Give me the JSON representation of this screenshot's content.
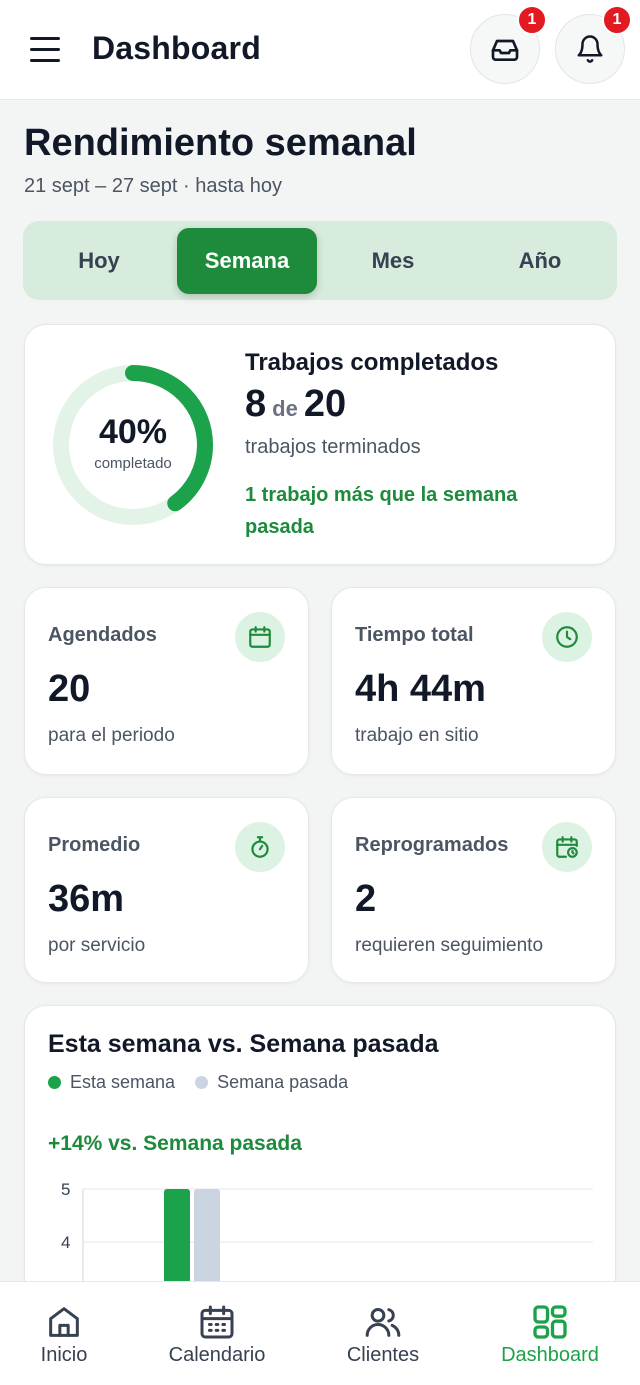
{
  "app": {
    "title": "Dashboard"
  },
  "header": {
    "menu_icon": "menu-icon",
    "inbox": {
      "icon": "inbox-icon",
      "badge": "1"
    },
    "notifications": {
      "icon": "bell-icon",
      "badge": "1"
    }
  },
  "page": {
    "title": "Rendimiento semanal",
    "date_range": "21 sept – 27 sept · hasta hoy"
  },
  "segments": {
    "items": [
      "Hoy",
      "Semana",
      "Mes",
      "Año"
    ],
    "selected": "Semana"
  },
  "summary": {
    "percent_label": "40%",
    "percent_value": 0.4,
    "percent_caption": "completado",
    "title": "Trabajos completados",
    "completed": "8",
    "of_word": "de",
    "total": "20",
    "description": "trabajos terminados",
    "delta": "1 trabajo más que la semana pasada"
  },
  "stats": [
    {
      "label": "Agendados",
      "value": "20",
      "sub": "para el periodo",
      "icon": "calendar-icon"
    },
    {
      "label": "Tiempo total",
      "value": "4h 44m",
      "sub": "trabajo en sitio",
      "icon": "clock-icon"
    },
    {
      "label": "Promedio",
      "value": "36m",
      "sub": "por servicio",
      "icon": "stopwatch-icon"
    },
    {
      "label": "Reprogramados",
      "value": "2",
      "sub": "requieren seguimiento",
      "icon": "calendar-clock-icon"
    }
  ],
  "comparison": {
    "title": "Esta semana vs. Semana pasada",
    "legend": [
      "Esta semana",
      "Semana pasada"
    ],
    "delta": "+14% vs. Semana pasada"
  },
  "chart_data": {
    "type": "bar",
    "title": "Esta semana vs. Semana pasada",
    "series": [
      {
        "name": "Esta semana",
        "values": [
          5
        ]
      },
      {
        "name": "Semana pasada",
        "values": [
          5
        ]
      }
    ],
    "ylim": [
      0,
      5
    ],
    "yticks": [
      "5",
      "4"
    ],
    "colors": [
      "#1ca24a",
      "#cbd5e1"
    ]
  },
  "nav": {
    "items": [
      {
        "label": "Inicio",
        "icon": "home-icon"
      },
      {
        "label": "Calendario",
        "icon": "calendar-icon"
      },
      {
        "label": "Clientes",
        "icon": "users-icon"
      },
      {
        "label": "Dashboard",
        "icon": "dashboard-grid-icon"
      }
    ],
    "active": "Dashboard"
  },
  "colors": {
    "accent": "#1e8a3c",
    "accent_light": "#d7ecdc",
    "badge": "#e21b23",
    "muted_bar": "#cbd5e1"
  }
}
